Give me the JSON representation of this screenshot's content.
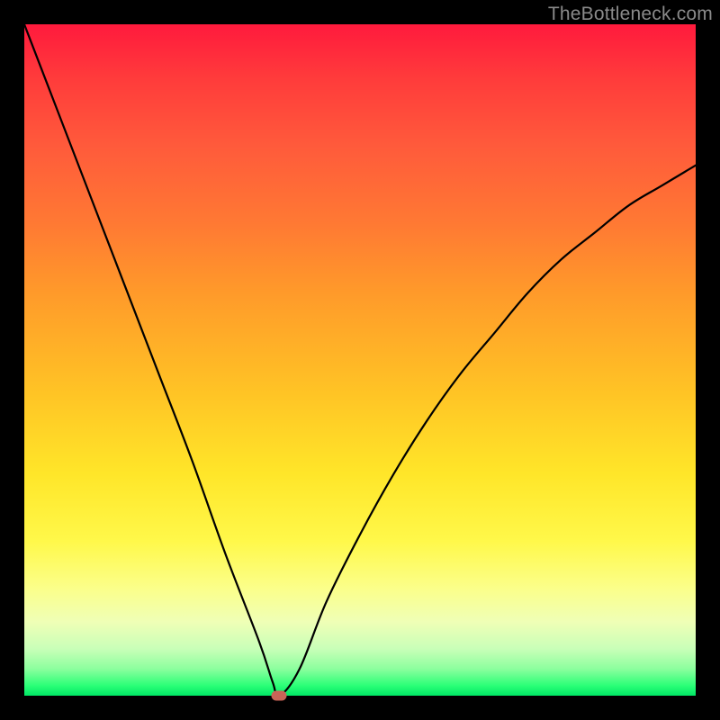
{
  "watermark": "TheBottleneck.com",
  "colors": {
    "frame": "#000000",
    "curve": "#000000",
    "marker": "#c96457",
    "watermark": "#8a8a8a"
  },
  "chart_data": {
    "type": "line",
    "title": "",
    "xlabel": "",
    "ylabel": "",
    "xlim": [
      0,
      100
    ],
    "ylim": [
      0,
      100
    ],
    "grid": false,
    "series": [
      {
        "name": "bottleneck-curve",
        "x": [
          0,
          5,
          10,
          15,
          20,
          25,
          30,
          35,
          37,
          38,
          41,
          45,
          50,
          55,
          60,
          65,
          70,
          75,
          80,
          85,
          90,
          95,
          100
        ],
        "values": [
          100,
          87,
          74,
          61,
          48,
          35,
          21,
          8,
          2,
          0,
          4,
          14,
          24,
          33,
          41,
          48,
          54,
          60,
          65,
          69,
          73,
          76,
          79
        ]
      }
    ],
    "marker": {
      "x": 38,
      "y": 0
    }
  }
}
